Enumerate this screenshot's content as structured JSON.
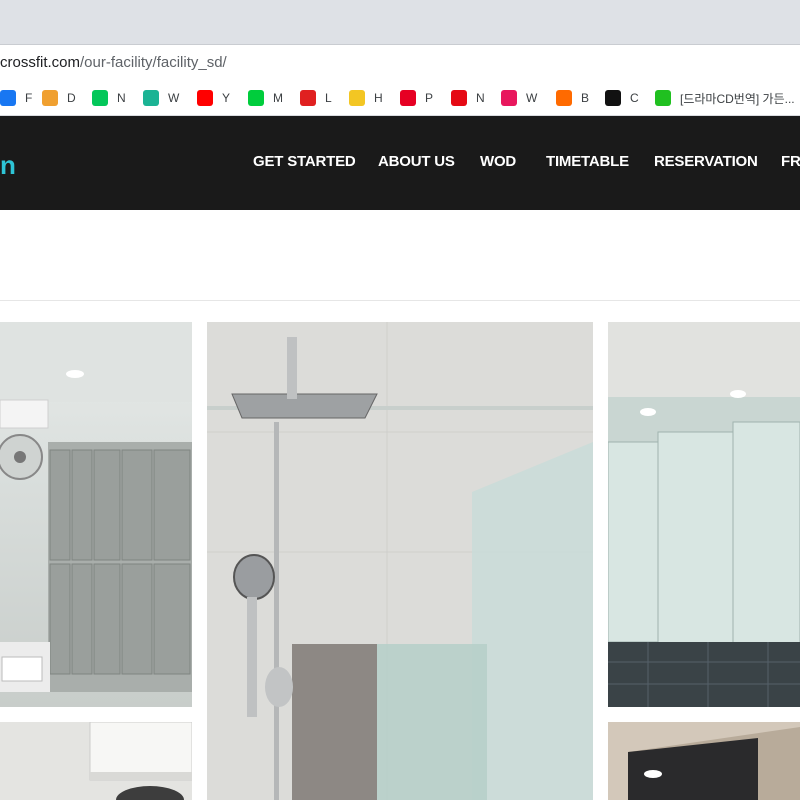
{
  "browser": {
    "url_host": "crossfit.com",
    "url_path": "/our-facility/facility_sd/",
    "bookmarks": [
      {
        "label": "F",
        "icon": "facebook-icon",
        "color": "#1877f2"
      },
      {
        "label": "D",
        "icon": "daum-icon",
        "color": "#f0a030"
      },
      {
        "label": "N",
        "icon": "naver-icon",
        "color": "#03c75a"
      },
      {
        "label": "W",
        "icon": "whale-icon",
        "color": "#1bb394"
      },
      {
        "label": "Y",
        "icon": "youtube-icon",
        "color": "#ff0000"
      },
      {
        "label": "M",
        "icon": "melon-icon",
        "color": "#00cd3c"
      },
      {
        "label": "L",
        "icon": "l-icon",
        "color": "#e02020"
      },
      {
        "label": "H",
        "icon": "h-icon",
        "color": "#f3c623"
      },
      {
        "label": "P",
        "icon": "pinterest-icon",
        "color": "#e60023"
      },
      {
        "label": "N",
        "icon": "netflix-icon",
        "color": "#e50914"
      },
      {
        "label": "W",
        "icon": "w-icon",
        "color": "#e8175d"
      },
      {
        "label": "B",
        "icon": "b-icon",
        "color": "#ff6a00"
      },
      {
        "label": "C",
        "icon": "c-icon",
        "color": "#111111"
      },
      {
        "label": "[드라마CD번역] 가든...",
        "icon": "blog-icon",
        "color": "#20c020"
      }
    ]
  },
  "site": {
    "logo": "n",
    "nav": [
      "GET STARTED",
      "ABOUT US",
      "WOD",
      "TIMETABLE",
      "RESERVATION",
      "FR"
    ]
  },
  "colors": {
    "header_bg": "#1a1a1a",
    "accent": "#2ec4d6"
  }
}
